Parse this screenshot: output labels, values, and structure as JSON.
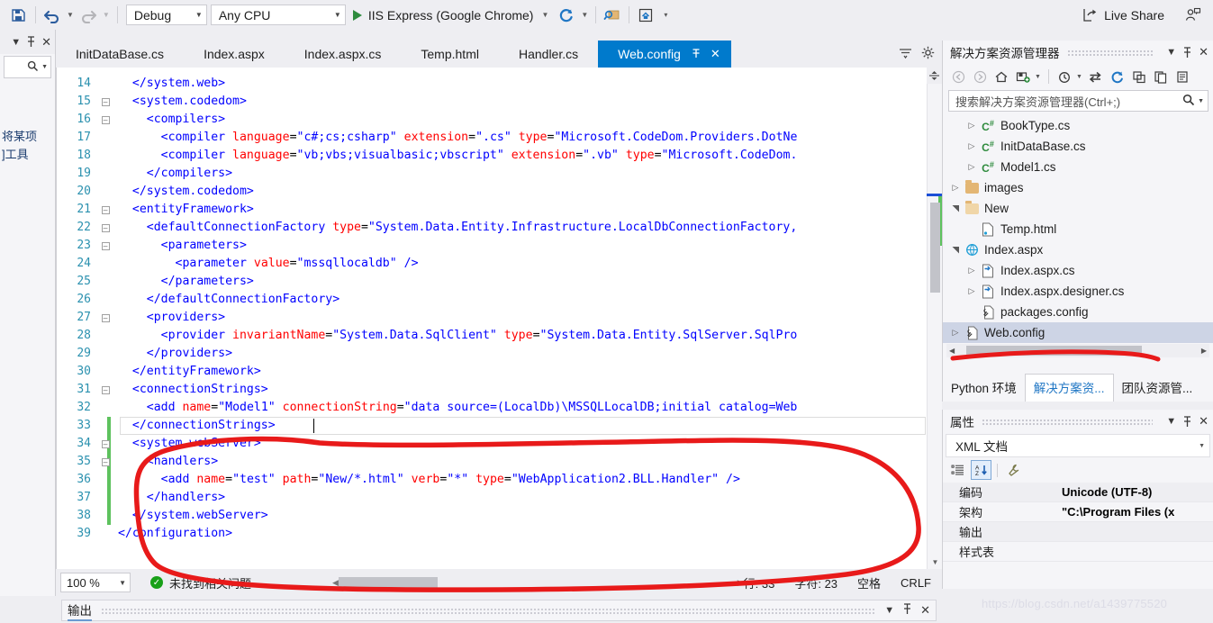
{
  "toolbar": {
    "save_icon": "save-all-icon",
    "undo_icon": "undo-icon",
    "redo_icon": "redo-icon",
    "config_value": "Debug",
    "platform_value": "Any CPU",
    "run_label": "IIS Express (Google Chrome)",
    "refresh_icon": "browser-refresh-icon",
    "search_icon": "quick-launch-icon",
    "home_icon": "home-frame-icon",
    "overflow_icon": "toolbar-overflow-icon",
    "live_share_label": "Live Share",
    "feedback_icon": "send-feedback-icon"
  },
  "left_dock": {
    "title_dropdown_icon": "chevron-down-icon",
    "pin_icon": "pin-icon",
    "close_icon": "close-icon",
    "search_icon": "search-icon",
    "search_caret_icon": "chevron-down-icon",
    "text_line1": "将某项",
    "text_line2": "]工具"
  },
  "tabs": {
    "items": [
      {
        "label": "InitDataBase.cs",
        "active": false
      },
      {
        "label": "Index.aspx",
        "active": false
      },
      {
        "label": "Index.aspx.cs",
        "active": false
      },
      {
        "label": "Temp.html",
        "active": false
      },
      {
        "label": "Handler.cs",
        "active": false
      },
      {
        "label": "Web.config",
        "active": true
      }
    ],
    "pin_icon": "pin-icon",
    "close_icon": "close-icon",
    "overflow_icon": "tab-list-icon",
    "settings_icon": "gear-icon"
  },
  "editor": {
    "lines": [
      {
        "no": "14",
        "indent": 2,
        "fold": "none",
        "changed": false,
        "tokens": [
          {
            "t": "tag",
            "s": "</system.web>"
          }
        ]
      },
      {
        "no": "15",
        "indent": 2,
        "fold": "minus",
        "changed": false,
        "tokens": [
          {
            "t": "tag",
            "s": "<system.codedom>"
          }
        ]
      },
      {
        "no": "16",
        "indent": 4,
        "fold": "minus",
        "changed": false,
        "tokens": [
          {
            "t": "tag",
            "s": "<compilers>"
          }
        ]
      },
      {
        "no": "17",
        "indent": 6,
        "fold": "line",
        "changed": false,
        "tokens": [
          {
            "t": "tag",
            "s": "<compiler "
          },
          {
            "t": "attr",
            "s": "language"
          },
          {
            "t": "plain",
            "s": "="
          },
          {
            "t": "val",
            "s": "\"c#;cs;csharp\""
          },
          {
            "t": "plain",
            "s": " "
          },
          {
            "t": "attr",
            "s": "extension"
          },
          {
            "t": "plain",
            "s": "="
          },
          {
            "t": "val",
            "s": "\".cs\""
          },
          {
            "t": "plain",
            "s": " "
          },
          {
            "t": "attr",
            "s": "type"
          },
          {
            "t": "plain",
            "s": "="
          },
          {
            "t": "val",
            "s": "\"Microsoft.CodeDom.Providers.DotNe"
          }
        ]
      },
      {
        "no": "18",
        "indent": 6,
        "fold": "line",
        "changed": false,
        "tokens": [
          {
            "t": "tag",
            "s": "<compiler "
          },
          {
            "t": "attr",
            "s": "language"
          },
          {
            "t": "plain",
            "s": "="
          },
          {
            "t": "val",
            "s": "\"vb;vbs;visualbasic;vbscript\""
          },
          {
            "t": "plain",
            "s": " "
          },
          {
            "t": "attr",
            "s": "extension"
          },
          {
            "t": "plain",
            "s": "="
          },
          {
            "t": "val",
            "s": "\".vb\""
          },
          {
            "t": "plain",
            "s": " "
          },
          {
            "t": "attr",
            "s": "type"
          },
          {
            "t": "plain",
            "s": "="
          },
          {
            "t": "val",
            "s": "\"Microsoft.CodeDom."
          }
        ]
      },
      {
        "no": "19",
        "indent": 4,
        "fold": "line",
        "changed": false,
        "tokens": [
          {
            "t": "tag",
            "s": "</compilers>"
          }
        ]
      },
      {
        "no": "20",
        "indent": 2,
        "fold": "line",
        "changed": false,
        "tokens": [
          {
            "t": "tag",
            "s": "</system.codedom>"
          }
        ]
      },
      {
        "no": "21",
        "indent": 2,
        "fold": "minus",
        "changed": false,
        "tokens": [
          {
            "t": "tag",
            "s": "<entityFramework>"
          }
        ]
      },
      {
        "no": "22",
        "indent": 4,
        "fold": "minus",
        "changed": false,
        "tokens": [
          {
            "t": "tag",
            "s": "<defaultConnectionFactory "
          },
          {
            "t": "attr",
            "s": "type"
          },
          {
            "t": "plain",
            "s": "="
          },
          {
            "t": "val",
            "s": "\"System.Data.Entity.Infrastructure.LocalDbConnectionFactory,"
          }
        ]
      },
      {
        "no": "23",
        "indent": 6,
        "fold": "minus",
        "changed": false,
        "tokens": [
          {
            "t": "tag",
            "s": "<parameters>"
          }
        ]
      },
      {
        "no": "24",
        "indent": 8,
        "fold": "line",
        "changed": false,
        "tokens": [
          {
            "t": "tag",
            "s": "<parameter "
          },
          {
            "t": "attr",
            "s": "value"
          },
          {
            "t": "plain",
            "s": "="
          },
          {
            "t": "val",
            "s": "\"mssqllocaldb\""
          },
          {
            "t": "plain",
            "s": " "
          },
          {
            "t": "tag",
            "s": "/>"
          }
        ]
      },
      {
        "no": "25",
        "indent": 6,
        "fold": "line",
        "changed": false,
        "tokens": [
          {
            "t": "tag",
            "s": "</parameters>"
          }
        ]
      },
      {
        "no": "26",
        "indent": 4,
        "fold": "line",
        "changed": false,
        "tokens": [
          {
            "t": "tag",
            "s": "</defaultConnectionFactory>"
          }
        ]
      },
      {
        "no": "27",
        "indent": 4,
        "fold": "minus",
        "changed": false,
        "tokens": [
          {
            "t": "tag",
            "s": "<providers>"
          }
        ]
      },
      {
        "no": "28",
        "indent": 6,
        "fold": "line",
        "changed": false,
        "tokens": [
          {
            "t": "tag",
            "s": "<provider "
          },
          {
            "t": "attr",
            "s": "invariantName"
          },
          {
            "t": "plain",
            "s": "="
          },
          {
            "t": "val",
            "s": "\"System.Data.SqlClient\""
          },
          {
            "t": "plain",
            "s": " "
          },
          {
            "t": "attr",
            "s": "type"
          },
          {
            "t": "plain",
            "s": "="
          },
          {
            "t": "val",
            "s": "\"System.Data.Entity.SqlServer.SqlPro"
          }
        ]
      },
      {
        "no": "29",
        "indent": 4,
        "fold": "line",
        "changed": false,
        "tokens": [
          {
            "t": "tag",
            "s": "</providers>"
          }
        ]
      },
      {
        "no": "30",
        "indent": 2,
        "fold": "line",
        "changed": false,
        "tokens": [
          {
            "t": "tag",
            "s": "</entityFramework>"
          }
        ]
      },
      {
        "no": "31",
        "indent": 2,
        "fold": "minus",
        "changed": false,
        "tokens": [
          {
            "t": "tag",
            "s": "<connectionStrings>"
          }
        ]
      },
      {
        "no": "32",
        "indent": 4,
        "fold": "line",
        "changed": false,
        "tokens": [
          {
            "t": "tag",
            "s": "<add "
          },
          {
            "t": "attr",
            "s": "name"
          },
          {
            "t": "plain",
            "s": "="
          },
          {
            "t": "val",
            "s": "\"Model1\""
          },
          {
            "t": "plain",
            "s": " "
          },
          {
            "t": "attr",
            "s": "connectionString"
          },
          {
            "t": "plain",
            "s": "="
          },
          {
            "t": "val",
            "s": "\"data source=(LocalDb)\\MSSQLLocalDB;initial catalog=Web"
          }
        ]
      },
      {
        "no": "33",
        "indent": 2,
        "fold": "line",
        "changed": true,
        "current": true,
        "tokens": [
          {
            "t": "tag",
            "s": "</connectionStrings>"
          }
        ]
      },
      {
        "no": "34",
        "indent": 2,
        "fold": "minus",
        "changed": true,
        "tokens": [
          {
            "t": "tag",
            "s": "<system.webServer>"
          }
        ]
      },
      {
        "no": "35",
        "indent": 4,
        "fold": "minus",
        "changed": true,
        "tokens": [
          {
            "t": "tag",
            "s": "<handlers>"
          }
        ]
      },
      {
        "no": "36",
        "indent": 6,
        "fold": "line",
        "changed": true,
        "tokens": [
          {
            "t": "tag",
            "s": "<add "
          },
          {
            "t": "attr",
            "s": "name"
          },
          {
            "t": "plain",
            "s": "="
          },
          {
            "t": "val",
            "s": "\"test\""
          },
          {
            "t": "plain",
            "s": " "
          },
          {
            "t": "attr",
            "s": "path"
          },
          {
            "t": "plain",
            "s": "="
          },
          {
            "t": "val",
            "s": "\"New/*.html\""
          },
          {
            "t": "plain",
            "s": " "
          },
          {
            "t": "attr",
            "s": "verb"
          },
          {
            "t": "plain",
            "s": "="
          },
          {
            "t": "val",
            "s": "\"*\""
          },
          {
            "t": "plain",
            "s": " "
          },
          {
            "t": "attr",
            "s": "type"
          },
          {
            "t": "plain",
            "s": "="
          },
          {
            "t": "val",
            "s": "\"WebApplication2.BLL.Handler\""
          },
          {
            "t": "plain",
            "s": " "
          },
          {
            "t": "tag",
            "s": "/>"
          }
        ]
      },
      {
        "no": "37",
        "indent": 4,
        "fold": "line",
        "changed": true,
        "tokens": [
          {
            "t": "tag",
            "s": "</handlers>"
          }
        ]
      },
      {
        "no": "38",
        "indent": 2,
        "fold": "line",
        "changed": true,
        "tokens": [
          {
            "t": "tag",
            "s": "</system.webServer>"
          }
        ]
      },
      {
        "no": "39",
        "indent": 0,
        "fold": "line",
        "changed": false,
        "tokens": [
          {
            "t": "tag",
            "s": "</configuration>"
          }
        ]
      }
    ]
  },
  "status_bar": {
    "zoom": "100 %",
    "zoom_caret_icon": "chevron-down-icon",
    "issues_icon": "check-circle-icon",
    "issues_text": "未找到相关问题",
    "scroll_left_icon": "chevron-left-icon",
    "scroll_right_icon": "chevron-right-icon",
    "line_label": "行: 33",
    "col_label": "字符: 23",
    "indent_label": "空格",
    "eol_label": "CRLF"
  },
  "solution_explorer": {
    "title": "解决方案资源管理器",
    "dropdown_icon": "chevron-down-icon",
    "pin_icon": "pin-icon",
    "close_icon": "close-icon",
    "toolbar_icons": [
      "back-icon",
      "forward-icon",
      "home-icon",
      "new-folder-icon",
      "chevron-down-icon",
      "pending-changes-icon",
      "chevron-down-icon",
      "sync-with-active-document-icon",
      "refresh-icon",
      "collapse-all-icon",
      "show-all-files-icon",
      "properties-icon"
    ],
    "search_placeholder": "搜索解决方案资源管理器(Ctrl+;)",
    "search_icon": "search-icon",
    "search_caret_icon": "chevron-down-icon",
    "tree": [
      {
        "label": "BookType.cs",
        "indent": 3,
        "twisty": "collapsed",
        "icon": "csharp-file-icon",
        "selected": false
      },
      {
        "label": "InitDataBase.cs",
        "indent": 3,
        "twisty": "collapsed",
        "icon": "csharp-file-icon",
        "selected": false
      },
      {
        "label": "Model1.cs",
        "indent": 3,
        "twisty": "collapsed",
        "icon": "csharp-file-icon",
        "selected": false
      },
      {
        "label": "images",
        "indent": 2,
        "twisty": "collapsed",
        "icon": "folder-icon",
        "selected": false
      },
      {
        "label": "New",
        "indent": 2,
        "twisty": "expanded",
        "icon": "folder-open-icon",
        "selected": false
      },
      {
        "label": "Temp.html",
        "indent": 3,
        "twisty": "none",
        "icon": "html-file-icon",
        "selected": false
      },
      {
        "label": "Index.aspx",
        "indent": 2,
        "twisty": "expanded",
        "icon": "web-form-icon",
        "selected": false
      },
      {
        "label": "Index.aspx.cs",
        "indent": 3,
        "twisty": "collapsed",
        "icon": "code-behind-icon",
        "selected": false
      },
      {
        "label": "Index.aspx.designer.cs",
        "indent": 3,
        "twisty": "collapsed",
        "icon": "code-behind-icon",
        "selected": false
      },
      {
        "label": "packages.config",
        "indent": 3,
        "twisty": "none",
        "icon": "config-file-icon",
        "selected": false
      },
      {
        "label": "Web.config",
        "indent": 2,
        "twisty": "collapsed",
        "icon": "config-file-icon",
        "selected": true
      }
    ],
    "hscroll_left_icon": "chevron-left-icon",
    "hscroll_right_icon": "chevron-right-icon",
    "bottom_tabs": [
      {
        "label": "Python 环境",
        "active": false
      },
      {
        "label": "解决方案资...",
        "active": true
      },
      {
        "label": "团队资源管...",
        "active": false
      }
    ]
  },
  "properties": {
    "title": "属性",
    "dropdown_icon": "chevron-down-icon",
    "pin_icon": "pin-icon",
    "close_icon": "close-icon",
    "object_name": "XML 文档",
    "object_caret_icon": "chevron-down-icon",
    "toolbar": {
      "categorized_icon": "categorized-view-icon",
      "alphabetical_icon": "alphabetical-sort-icon",
      "properties_icon": "properties-wrench-icon"
    },
    "rows": [
      {
        "name": "编码",
        "value": "Unicode (UTF-8)"
      },
      {
        "name": "架构",
        "value": "\"C:\\Program Files (x"
      },
      {
        "name": "输出",
        "value": ""
      },
      {
        "name": "样式表",
        "value": ""
      }
    ]
  },
  "output_panel": {
    "title": "输出",
    "dropdown_icon": "chevron-down-icon",
    "pin_icon": "pin-icon",
    "close_icon": "close-icon"
  },
  "watermark": {
    "text": "https://blog.csdn.net/a1439775520"
  },
  "annotation": {
    "color": "#e81a1a",
    "description": "hand-drawn-red-ellipse"
  }
}
